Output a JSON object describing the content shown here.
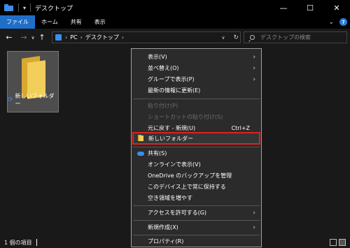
{
  "window": {
    "title": "デスクトップ",
    "controls": {
      "minimize": "—",
      "maximize": "☐",
      "close": "✕"
    }
  },
  "ribbon": {
    "tabs": [
      "ファイル",
      "ホーム",
      "共有",
      "表示"
    ],
    "expand_icon": "chevron-down",
    "help": "?"
  },
  "nav": {
    "back": "←",
    "forward": "→",
    "recent": "∨",
    "up": "↑",
    "breadcrumb": [
      "PC",
      "デスクトップ"
    ],
    "refresh": "↻",
    "dropdown": "∨",
    "search_placeholder": "デスクトップの検索"
  },
  "files": [
    {
      "name": "新しいフォルダー",
      "icon": "folder-icon",
      "selected": true
    }
  ],
  "status": {
    "item_count": "1 個の項目"
  },
  "context_menu": {
    "items": [
      {
        "label": "表示(V)",
        "submenu": true
      },
      {
        "label": "並べ替え(O)",
        "submenu": true
      },
      {
        "label": "グループで表示(P)",
        "submenu": true
      },
      {
        "label": "最新の情報に更新(E)"
      },
      {
        "label": "貼り付け(P)",
        "disabled": true
      },
      {
        "label": "ショートカットの貼り付け(S)",
        "disabled": true
      },
      {
        "label": "元に戻す - 新規(U)",
        "shortcut": "Ctrl+Z"
      },
      {
        "label": "新しいフォルダー",
        "highlight": true
      },
      {
        "label": "共有(S)"
      },
      {
        "label": "オンラインで表示(V)"
      },
      {
        "label": "OneDrive のバックアップを管理"
      },
      {
        "label": "このデバイス上で常に保持する"
      },
      {
        "label": "空き領域を増やす"
      },
      {
        "label": "アクセスを許可する(G)",
        "submenu": true
      },
      {
        "label": "新規作成(X)",
        "submenu": true
      },
      {
        "label": "プロパティ(R)"
      }
    ]
  },
  "colors": {
    "accent": "#1f6fc9",
    "background": "#191919",
    "menu_bg": "#2b2b2b",
    "highlight_border": "#e02020"
  }
}
